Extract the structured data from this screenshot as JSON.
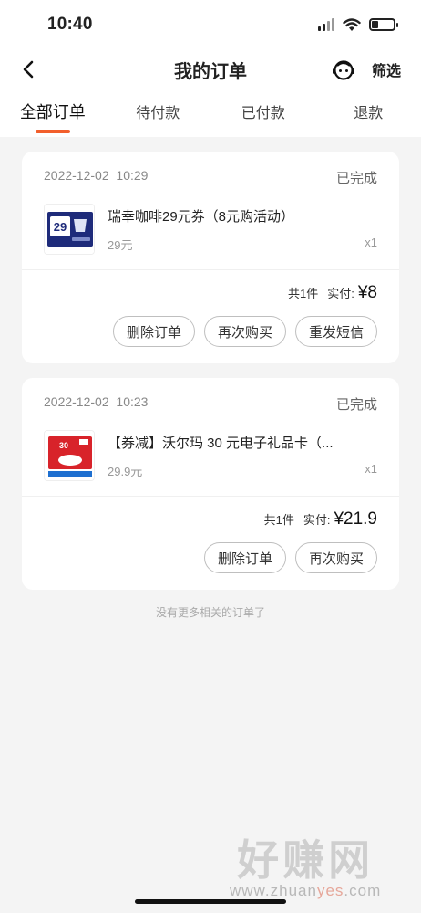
{
  "status_bar": {
    "time": "10:40"
  },
  "nav": {
    "title": "我的订单",
    "filter_label": "筛选"
  },
  "tabs": [
    {
      "label": "全部订单",
      "active": true
    },
    {
      "label": "待付款",
      "active": false
    },
    {
      "label": "已付款",
      "active": false
    },
    {
      "label": "退款",
      "active": false
    }
  ],
  "orders": [
    {
      "date": "2022-12-02",
      "time": "10:29",
      "status": "已完成",
      "product_name": "瑞幸咖啡29元券（8元购活动）",
      "price": "29元",
      "quantity": "x1",
      "count_label": "共1件",
      "paid_label": "实付:",
      "paid_amount": "¥8",
      "thumb_text": "29",
      "buttons": [
        "删除订单",
        "再次购买",
        "重发短信"
      ]
    },
    {
      "date": "2022-12-02",
      "time": "10:23",
      "status": "已完成",
      "product_name": "【券减】沃尔玛 30 元电子礼品卡（...",
      "price": "29.9元",
      "quantity": "x1",
      "count_label": "共1件",
      "paid_label": "实付:",
      "paid_amount": "¥21.9",
      "thumb_text": "30",
      "buttons": [
        "删除订单",
        "再次购买"
      ]
    }
  ],
  "footer_note": "没有更多相关的订单了",
  "watermark": {
    "main": "好赚网",
    "url_prefix": "www.zhuan",
    "url_highlight": "yes",
    "url_suffix": ".com"
  },
  "colors": {
    "accent": "#f25f2c",
    "background": "#f4f4f4"
  },
  "icons": [
    "back-arrow-icon",
    "customer-service-icon",
    "wifi-icon",
    "signal-icon",
    "battery-icon"
  ]
}
